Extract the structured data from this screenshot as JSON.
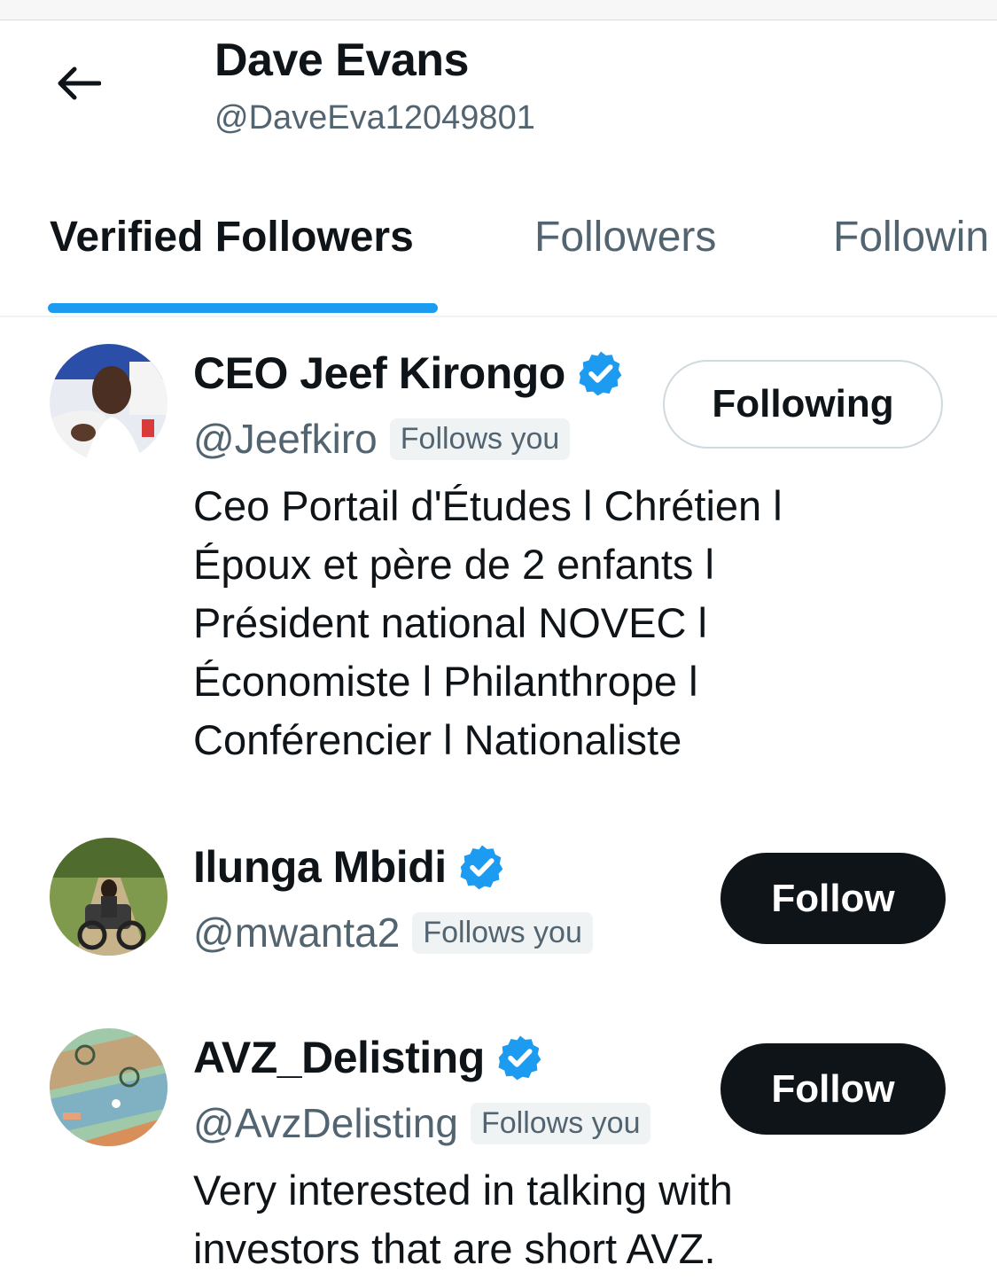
{
  "header": {
    "back_icon": "arrow-left-icon",
    "title": "Dave Evans",
    "handle": "@DaveEva12049801"
  },
  "tabs": [
    {
      "label": "Verified Followers",
      "active": true
    },
    {
      "label": "Followers",
      "active": false
    },
    {
      "label": "Followin",
      "active": false
    }
  ],
  "accounts": [
    {
      "name": "CEO Jeef Kirongo",
      "handle": "@Jeefkiro",
      "follows_you": "Follows you",
      "button": "Following",
      "verified_icon": "verified-badge-icon",
      "bio": [
        "Ceo Portail d'Études l Chrétien l",
        "Époux et père de 2 enfants l",
        "Président national NOVEC l",
        "Économiste l Philanthrope l",
        "Conférencier l Nationaliste"
      ]
    },
    {
      "name": "Ilunga Mbidi",
      "handle": "@mwanta2",
      "follows_you": "Follows you",
      "button": "Follow",
      "verified_icon": "verified-badge-icon"
    },
    {
      "name": "AVZ_Delisting",
      "handle": "@AvzDelisting",
      "follows_you": "Follows you",
      "button": "Follow",
      "verified_icon": "verified-badge-icon",
      "bio": [
        "Very interested in talking with",
        "investors that are short AVZ."
      ]
    }
  ],
  "colors": {
    "accent": "#1d9bf0",
    "text": "#0f1419",
    "secondary": "#536471",
    "button_dark": "#0f1419",
    "pill_bg": "#eff3f4"
  }
}
